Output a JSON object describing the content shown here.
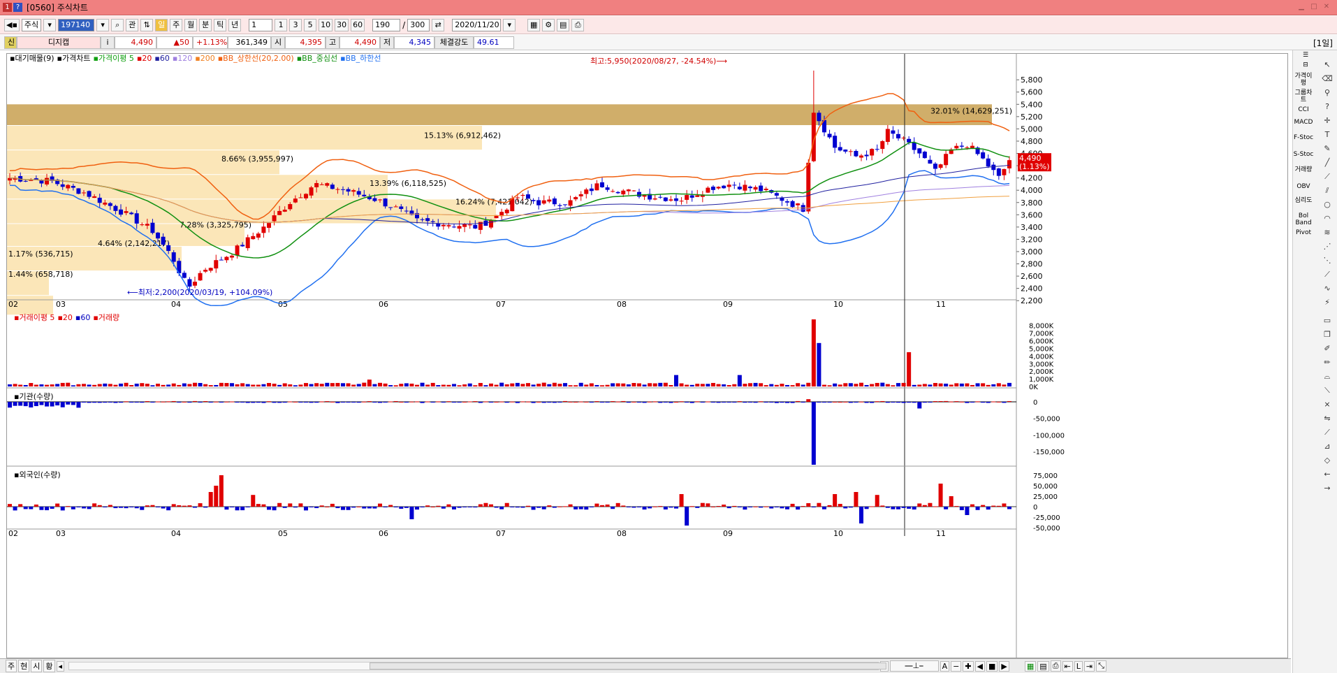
{
  "window": {
    "title": "[0560] 주식차트",
    "icon_a": "1",
    "icon_b": "?"
  },
  "toolbar": {
    "market": "주식",
    "code": "197140",
    "search_label": "관",
    "periods": [
      "일",
      "주",
      "월",
      "분",
      "틱",
      "년"
    ],
    "interval": "1",
    "presets": [
      "1",
      "3",
      "5",
      "10",
      "30",
      "60"
    ],
    "count": "190",
    "total": "300",
    "date": "2020/11/20"
  },
  "quote": {
    "badge": "신",
    "name": "디지캡",
    "price": "4,490",
    "change": "▲50",
    "change_pct": "+1.13%",
    "volume": "361,349",
    "open_label": "시",
    "open": "4,395",
    "high_label": "고",
    "high": "4,490",
    "low_label": "저",
    "low": "4,345",
    "strength_label": "체결강도",
    "strength": "49.61",
    "period_label": "[1일]"
  },
  "price_panel": {
    "legend": [
      "▪대기매물(9)",
      "▪가격차트",
      "▪가격이평 5",
      "▪20",
      "▪60",
      "▪120",
      "▪200",
      "▪BB_상한선(20,2.00)",
      "▪BB_중심선",
      "▪BB_하한선"
    ],
    "y_ticks": [
      "5,800",
      "5,600",
      "5,400",
      "5,200",
      "5,000",
      "4,800",
      "4,600",
      "4,400",
      "4,200",
      "4,000",
      "3,800",
      "3,600",
      "3,400",
      "3,200",
      "3,000",
      "2,800",
      "2,600",
      "2,400",
      "2,200"
    ],
    "x_ticks": [
      "02",
      "03",
      "04",
      "05",
      "06",
      "07",
      "08",
      "09",
      "10",
      "11"
    ],
    "high_note": "최고:5,950(2020/08/27, -24.54%)⟶",
    "low_note": "⟵최저:2,200(2020/03/19, +104.09%)",
    "last_price": "4,490",
    "last_pct": "(1.13%)",
    "supply_bands": [
      {
        "label": "32.01% (14,629,251)"
      },
      {
        "label": "15.13% (6,912,462)"
      },
      {
        "label": "8.66% (3,955,997)"
      },
      {
        "label": "13.39% (6,118,525)"
      },
      {
        "label": "16.24% (7,421,042)"
      },
      {
        "label": "7.28% (3,325,795)"
      },
      {
        "label": "4.64% (2,142,217)"
      },
      {
        "label": "1.17% (536,715)"
      },
      {
        "label": "1.44% (658,718)"
      }
    ]
  },
  "volume_panel": {
    "legend": [
      "▪거래이평 5",
      "▪20",
      "▪60",
      "▪거래량"
    ],
    "y_ticks": [
      "8,000K",
      "7,000K",
      "6,000K",
      "5,000K",
      "4,000K",
      "3,000K",
      "2,000K",
      "1,000K",
      "0K"
    ]
  },
  "inst_panel": {
    "legend": [
      "▪기관(수량)"
    ],
    "y_ticks": [
      "0",
      "-50,000",
      "-100,000",
      "-150,000"
    ]
  },
  "foreign_panel": {
    "legend": [
      "▪외국인(수량)"
    ],
    "y_ticks": [
      "75,000",
      "50,000",
      "25,000",
      "0",
      "-25,000",
      "-50,000"
    ]
  },
  "rightbar": {
    "items": [
      "가격이평",
      "그룹차트",
      "CCI",
      "MACD",
      "F-Stoc",
      "S-Stoc",
      "거래량",
      "OBV",
      "심리도",
      "Bol Band",
      "Pivot"
    ]
  },
  "bottombar": {
    "tabs": [
      "주",
      "현",
      "시",
      "황"
    ]
  },
  "colors": {
    "up": "#e00000",
    "down": "#0000d0",
    "ma5": "#e07020",
    "ma20": "#10a010",
    "ma60": "#2020a0",
    "bb_upper": "#f06010",
    "bb_mid": "#109010",
    "bb_lower": "#2070f0",
    "band": "#fbe6b8",
    "band_top": "#c8a050"
  }
}
